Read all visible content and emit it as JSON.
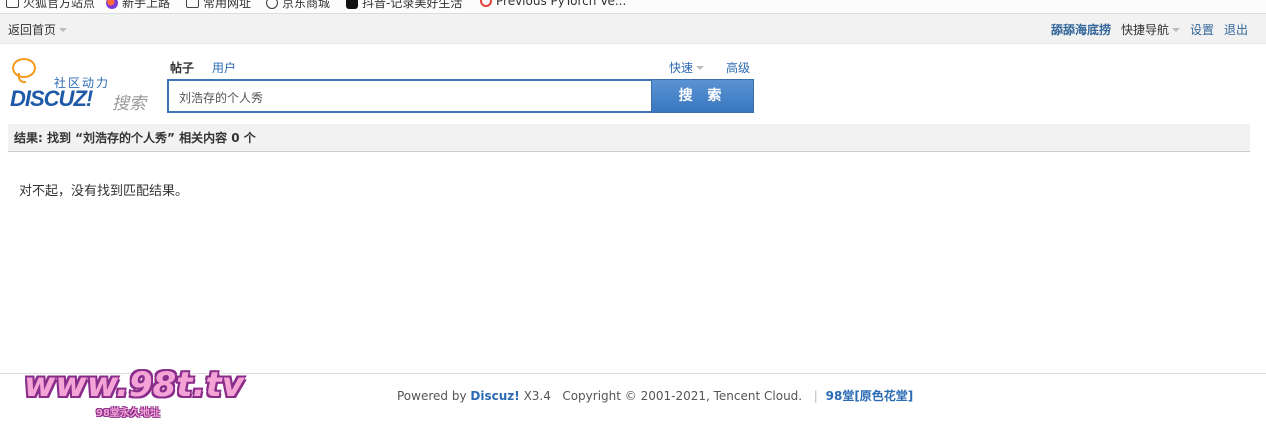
{
  "bookmarks": [
    {
      "icon": "folder-icon",
      "label": "火狐官方站点"
    },
    {
      "icon": "firefox-icon",
      "label": "新手上路"
    },
    {
      "icon": "folder-icon",
      "label": "常用网址"
    },
    {
      "icon": "globe-icon",
      "label": "京东商城"
    },
    {
      "icon": "tiktok-icon",
      "label": "抖音-记录美好生活"
    },
    {
      "icon": "ring-icon",
      "label": "Previous PyTorch Ve..."
    }
  ],
  "topnav": {
    "home": "返回首页",
    "username": "舔舔海底捞",
    "quick_nav": "快捷导航",
    "settings": "设置",
    "logout": "退出"
  },
  "logo": {
    "tagline": "社区动力",
    "brand": "DISCUZ!",
    "brand_sub": "搜索"
  },
  "search": {
    "tabs": [
      "帖子",
      "用户"
    ],
    "active_tab": "帖子",
    "quick": "快速",
    "advanced": "高级",
    "query": "刘浩存的个人秀",
    "button": "搜 索"
  },
  "results": {
    "summary": "结果: 找到 “刘浩存的个人秀” 相关内容 0 个",
    "message": "对不起，没有找到匹配结果。"
  },
  "footer": {
    "powered": "Powered by",
    "discuz": "Discuz!",
    "version": "X3.4",
    "copyright": "Copyright © 2001-2021, Tencent Cloud.",
    "separator": "|",
    "site": "98堂[原色花堂]"
  },
  "watermark": {
    "text": "www.98t.tv",
    "sub": "98堂永久地址"
  },
  "colors": {
    "link": "#336699",
    "button": "#3a77bf",
    "watermark": "#f4a3d6"
  }
}
